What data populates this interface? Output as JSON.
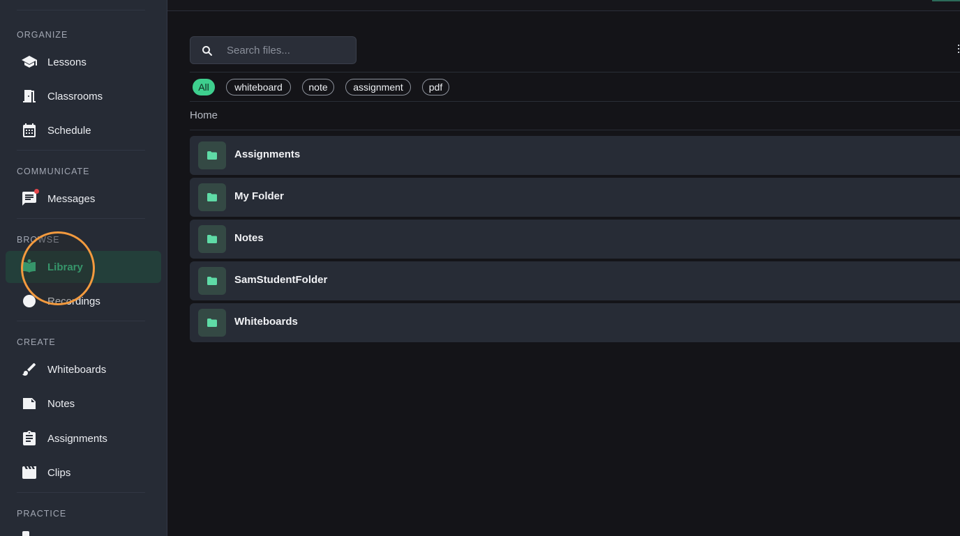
{
  "sidebar": {
    "sections": [
      {
        "title": "ORGANIZE",
        "items": [
          {
            "label": "Lessons",
            "icon": "graduation-cap-icon"
          },
          {
            "label": "Classrooms",
            "icon": "door-icon"
          },
          {
            "label": "Schedule",
            "icon": "calendar-icon"
          }
        ]
      },
      {
        "title": "COMMUNICATE",
        "items": [
          {
            "label": "Messages",
            "icon": "chat-icon",
            "badge": true
          }
        ]
      },
      {
        "title": "BROWSE",
        "items": [
          {
            "label": "Library",
            "icon": "book-icon",
            "active": true
          },
          {
            "label": "Recordings",
            "icon": "record-dot-icon"
          }
        ]
      },
      {
        "title": "CREATE",
        "items": [
          {
            "label": "Whiteboards",
            "icon": "brush-icon"
          },
          {
            "label": "Notes",
            "icon": "note-icon"
          },
          {
            "label": "Assignments",
            "icon": "clipboard-icon"
          },
          {
            "label": "Clips",
            "icon": "clapperboard-icon"
          }
        ]
      },
      {
        "title": "PRACTICE",
        "items": []
      }
    ]
  },
  "search": {
    "placeholder": "Search files...",
    "value": ""
  },
  "filters": [
    {
      "label": "All",
      "active": true
    },
    {
      "label": "whiteboard"
    },
    {
      "label": "note"
    },
    {
      "label": "assignment"
    },
    {
      "label": "pdf"
    }
  ],
  "breadcrumb": "Home",
  "folders": [
    "Assignments",
    "My Folder",
    "Notes",
    "SamStudentFolder",
    "Whiteboards"
  ],
  "colors": {
    "accent": "#3ecf8e",
    "highlight": "#f39a3e",
    "badge": "#e5484d"
  }
}
